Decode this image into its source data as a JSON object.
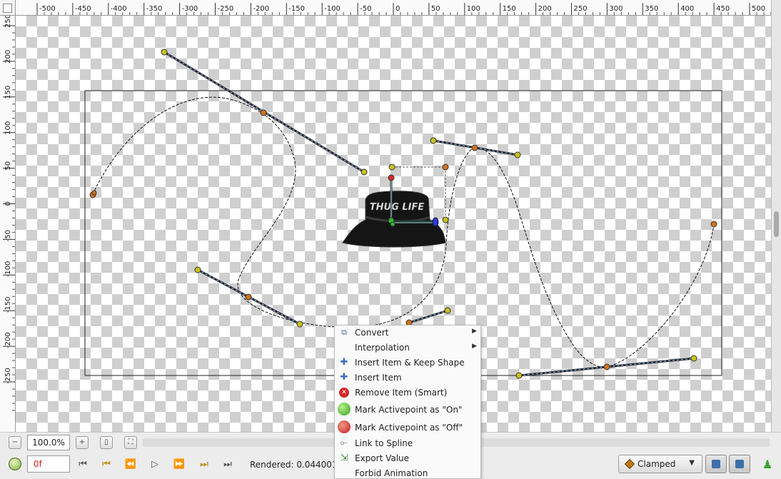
{
  "rulers": {
    "horizontal_labels": [
      "-500",
      "-450",
      "-400",
      "-350",
      "-300",
      "-250",
      "-200",
      "-150",
      "-100",
      "-50",
      "0",
      "50",
      "100",
      "150",
      "200",
      "250",
      "300",
      "350",
      "400",
      "450",
      "500"
    ],
    "vertical_labels": [
      "250",
      "200",
      "150",
      "100",
      "50",
      "0",
      "-50",
      "-100",
      "-150",
      "-200",
      "-250"
    ]
  },
  "canvas": {
    "artwork_text": "THUG LIFE"
  },
  "zoombar": {
    "zoom_value": "100.0%"
  },
  "timebar": {
    "time_value": "0f",
    "rendered_text": "Rendered: 0.044001",
    "interpolation_value": "Clamped"
  },
  "context_menu": {
    "items": [
      {
        "label": "Convert",
        "icon": "convert-icon",
        "submenu": true
      },
      {
        "label": "Interpolation",
        "icon": "",
        "submenu": true
      },
      {
        "label": "Insert Item & Keep Shape",
        "icon": "plus-icon",
        "submenu": false
      },
      {
        "label": "Insert Item",
        "icon": "plus-icon",
        "submenu": false
      },
      {
        "label": "Remove Item (Smart)",
        "icon": "remove-icon",
        "submenu": false
      },
      {
        "label": "Mark Activepoint as \"On\"",
        "icon": "green-ball-icon",
        "submenu": false
      },
      {
        "label": "Mark Activepoint as \"Off\"",
        "icon": "red-ball-icon",
        "submenu": false
      },
      {
        "label": "Link to Spline",
        "icon": "link-spline-icon",
        "submenu": false
      },
      {
        "label": "Export Value",
        "icon": "export-icon",
        "submenu": false
      },
      {
        "label": "Forbid Animation",
        "icon": "",
        "submenu": false
      }
    ]
  },
  "colors": {
    "vertex_handle": "#c8c21a",
    "tangent_handle": "#d0731c",
    "origin_handle": "#2bbd2b",
    "angle_handle": "#d42a2a",
    "width_handle": "#2c3ad6",
    "time_text": "#dd2222"
  }
}
